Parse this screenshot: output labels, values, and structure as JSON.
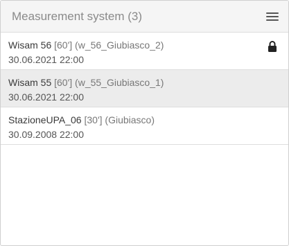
{
  "header": {
    "title": "Measurement system (3)",
    "menu_icon": "hamburger-menu-icon"
  },
  "items": [
    {
      "name": "Wisam 56",
      "interval": "[60']",
      "code": "(w_56_Giubiasco_2)",
      "date": "30.06.2021 22:00",
      "locked": true,
      "selected": false
    },
    {
      "name": "Wisam 55",
      "interval": "[60']",
      "code": "(w_55_Giubiasco_1)",
      "date": "30.06.2021 22:00",
      "locked": false,
      "selected": true
    },
    {
      "name": "StazioneUPA_06",
      "interval": "[30']",
      "code": "(Giubiasco)",
      "date": "30.09.2008 22:00",
      "locked": false,
      "selected": false
    }
  ],
  "colors": {
    "header_bg": "#f5f5f5",
    "selected_bg": "#ececec",
    "border": "#dedede"
  }
}
